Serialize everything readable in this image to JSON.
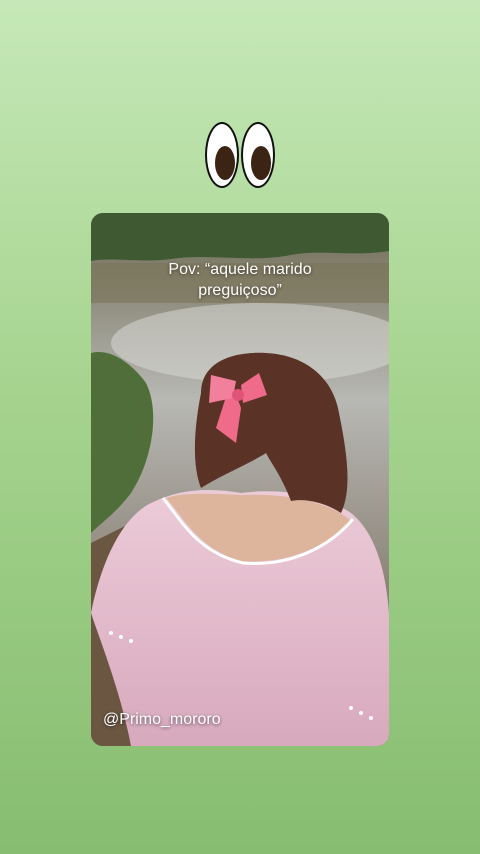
{
  "story": {
    "sticker": {
      "icon": "googly-eyes-icon"
    },
    "video": {
      "caption": "Pov: “aquele marido preguiçoso”",
      "username": "@Primo_mororo"
    }
  },
  "colors": {
    "background_top": "#c6e8b8",
    "background_bottom": "#86bd70",
    "shirt": "#e6bfd0",
    "bow": "#f06a8a"
  }
}
